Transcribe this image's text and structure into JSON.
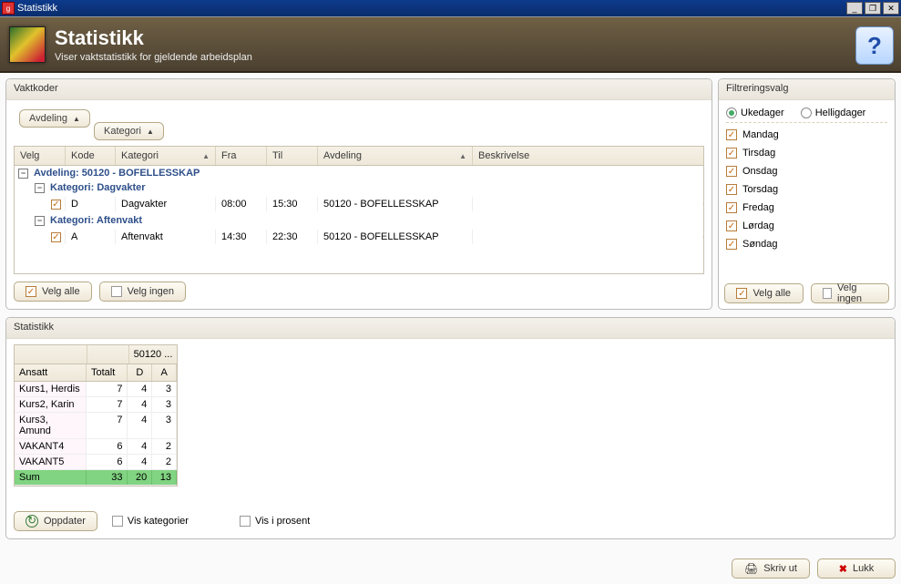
{
  "window": {
    "title": "Statistikk"
  },
  "header": {
    "title": "Statistikk",
    "subtitle": "Viser vaktstatistikk for gjeldende arbeidsplan"
  },
  "vaktkoder": {
    "panel_title": "Vaktkoder",
    "group_buttons": {
      "avdeling": "Avdeling",
      "kategori": "Kategori"
    },
    "columns": {
      "velg": "Velg",
      "kode": "Kode",
      "kategori": "Kategori",
      "fra": "Fra",
      "til": "Til",
      "avdeling": "Avdeling",
      "beskrivelse": "Beskrivelse"
    },
    "tree": {
      "avdeling_label": "Avdeling: 50120 - BOFELLESSKAP",
      "kat1_label": "Kategori: Dagvakter",
      "row1": {
        "kode": "D",
        "kategori": "Dagvakter",
        "fra": "08:00",
        "til": "15:30",
        "avdeling": "50120 - BOFELLESSKAP"
      },
      "kat2_label": "Kategori: Aftenvakt",
      "row2": {
        "kode": "A",
        "kategori": "Aftenvakt",
        "fra": "14:30",
        "til": "22:30",
        "avdeling": "50120 - BOFELLESSKAP"
      }
    },
    "buttons": {
      "select_all": "Velg alle",
      "select_none": "Velg ingen"
    }
  },
  "filter": {
    "panel_title": "Filtreringsvalg",
    "radio_weekdays": "Ukedager",
    "radio_holidays": "Helligdager",
    "days": {
      "mon": "Mandag",
      "tue": "Tirsdag",
      "wed": "Onsdag",
      "thu": "Torsdag",
      "fri": "Fredag",
      "sat": "Lørdag",
      "sun": "Søndag"
    },
    "buttons": {
      "select_all": "Velg alle",
      "select_none": "Velg ingen"
    }
  },
  "stat": {
    "panel_title": "Statistikk",
    "dept_header": "50120 ...",
    "columns": {
      "ansatt": "Ansatt",
      "totalt": "Totalt",
      "d": "D",
      "a": "A"
    },
    "rows": [
      {
        "ansatt": "Kurs1, Herdis",
        "totalt": "7",
        "d": "4",
        "a": "3"
      },
      {
        "ansatt": "Kurs2, Karin",
        "totalt": "7",
        "d": "4",
        "a": "3"
      },
      {
        "ansatt": "Kurs3, Amund",
        "totalt": "7",
        "d": "4",
        "a": "3"
      },
      {
        "ansatt": "VAKANT4",
        "totalt": "6",
        "d": "4",
        "a": "2"
      },
      {
        "ansatt": "VAKANT5",
        "totalt": "6",
        "d": "4",
        "a": "2"
      }
    ],
    "sum": {
      "ansatt": "Sum",
      "totalt": "33",
      "d": "20",
      "a": "13"
    },
    "buttons": {
      "refresh": "Oppdater",
      "show_cat": "Vis kategorier",
      "show_pct": "Vis i prosent"
    }
  },
  "footer": {
    "print": "Skriv ut",
    "close": "Lukk"
  }
}
